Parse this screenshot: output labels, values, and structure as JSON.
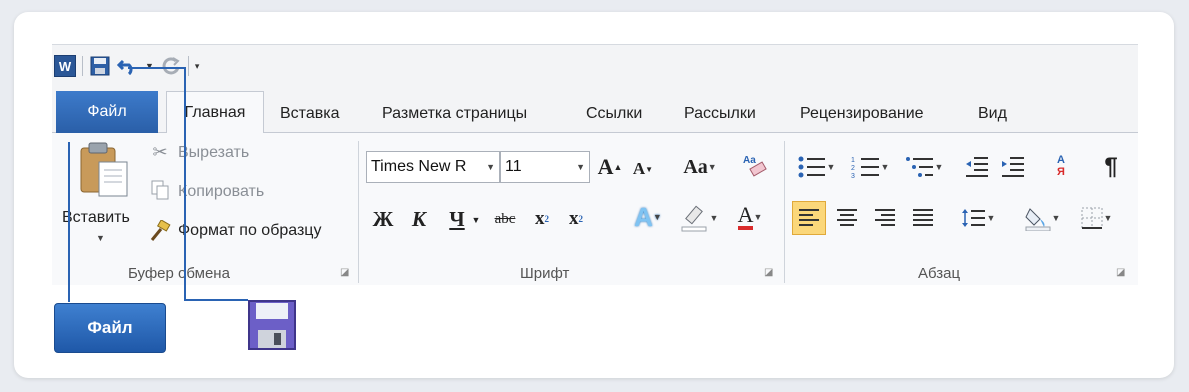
{
  "qat": {
    "word_icon": "W",
    "save_icon": "save-icon",
    "undo_icon": "undo-icon",
    "redo_icon": "redo-icon",
    "customize_icon": "customize-arrow-icon"
  },
  "tabs": {
    "file": "Файл",
    "home": "Главная",
    "items": [
      "Вставка",
      "Разметка страницы",
      "Ссылки",
      "Рассылки",
      "Рецензирование",
      "Вид"
    ]
  },
  "clipboard": {
    "paste": "Вставить",
    "cut": "Вырезать",
    "copy": "Копировать",
    "format_painter": "Формат по образцу",
    "label": "Буфер обмена"
  },
  "font": {
    "name": "Times New R",
    "size": "11",
    "grow": "A",
    "shrink": "A",
    "case": "Aa",
    "bold": "Ж",
    "italic": "К",
    "underline": "Ч",
    "strike": "abc",
    "subscript": "x",
    "superscript": "x",
    "sub_mark": "2",
    "sup_mark": "2",
    "effects": "A",
    "color": "A",
    "label": "Шрифт"
  },
  "paragraph": {
    "label": "Абзац",
    "pilcrow": "¶",
    "sort_top": "А",
    "sort_bottom": "Я"
  },
  "callouts": {
    "file_button": "Файл"
  },
  "colors": {
    "accent": "#2a5fa8",
    "highlight": "#fbd77a",
    "font_color": "#d92b2b"
  }
}
